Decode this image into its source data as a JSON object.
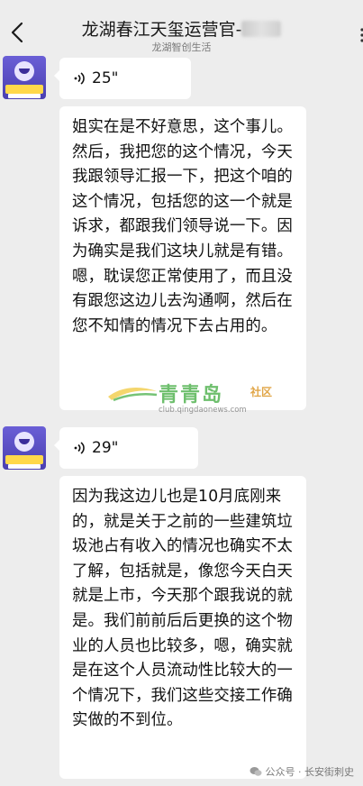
{
  "header": {
    "title": "龙湖春江天玺运营官-",
    "subtitle": "龙湖智创生活"
  },
  "messages": [
    {
      "type": "voice",
      "duration": "25\""
    },
    {
      "type": "text",
      "text": "姐实在是不好意思，这个事儿。然后，我把您的这个情况，今天我跟领导汇报一下，把这个咱的这个情况，包括您的这一个就是诉求，都跟我们领导说一下。因为确实是我们这块儿就是有错。嗯，耽误您正常使用了，而且没有跟您这边儿去沟通啊，然后在您不知情的情况下去占用的。"
    },
    {
      "type": "voice",
      "duration": "29\""
    },
    {
      "type": "text",
      "text": "因为我这边儿也是10月底刚来的，就是关于之前的一些建筑垃圾池占有收入的情况也确实不太了解，包括就是，像您今天白天就是上市，今天那个跟我说的就是。我们前前后后更换的这个物业的人员也比较多，嗯，确实就是在这个人员流动性比较大的一个情况下，我们这些交接工作确实做的不到位。"
    }
  ],
  "watermark": {
    "name": "青青岛",
    "suffix": "社区",
    "url": "club.qingdaonews.com"
  },
  "footer": {
    "label": "公众号 · 长安街刺史"
  }
}
